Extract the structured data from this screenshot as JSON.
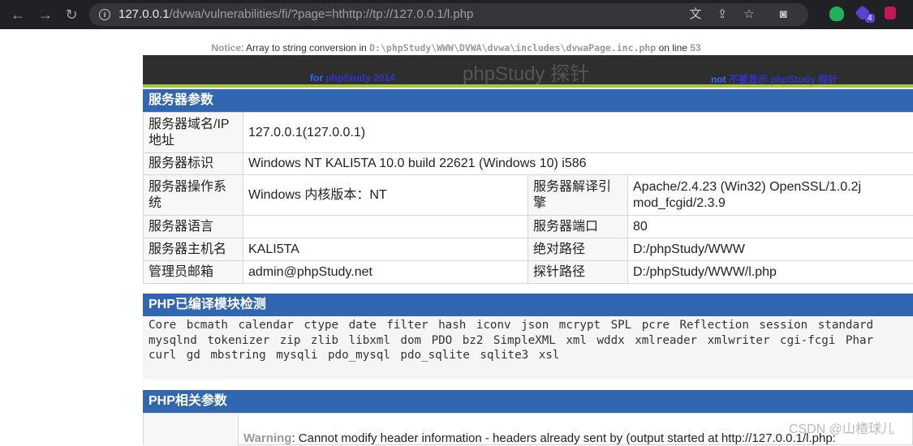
{
  "browser": {
    "url_host": "127.0.0.1",
    "url_path": "/dvwa/vulnerabilities/fi/?page=hthttp://tp://127.0.0.1/l.php",
    "extension_badge": "4"
  },
  "notice": {
    "label": "Notice",
    "message": ": Array to string conversion in ",
    "path": "D:\\phpStudy\\WWW\\DVWA\\dvwa\\includes\\dvwaPage.inc.php",
    "on_line": " on line ",
    "line": "53"
  },
  "banner": {
    "title": "phpStudy 探针",
    "left_prefix": "for ",
    "left_link": "phpStudy 2014",
    "right_prefix": "not ",
    "right_link": "不要显示 phpStudy 探针"
  },
  "server": {
    "heading": "服务器参数",
    "rows": [
      {
        "k1": "服务器域名/IP地址",
        "v1": "127.0.0.1(127.0.0.1)"
      },
      {
        "k1": "服务器标识",
        "v1": "Windows NT KALI5TA 10.0 build 22621 (Windows 10) i586"
      },
      {
        "k1": "服务器操作系统",
        "v1": "Windows  内核版本：NT",
        "k2": "服务器解译引擎",
        "v2": "Apache/2.4.23 (Win32) OpenSSL/1.0.2j mod_fcgid/2.3.9"
      },
      {
        "k1": "服务器语言",
        "v1": "",
        "k2": "服务器端口",
        "v2": "80"
      },
      {
        "k1": "服务器主机名",
        "v1": "KALI5TA",
        "k2": "绝对路径",
        "v2": "D:/phpStudy/WWW"
      },
      {
        "k1": "管理员邮箱",
        "v1": "admin@phpStudy.net",
        "k2": "探针路径",
        "v2": "D:/phpStudy/WWW/l.php"
      }
    ]
  },
  "modules": {
    "heading": "PHP已编译模块检测",
    "text": "Core  bcmath  calendar  ctype  date  filter  hash  iconv  json  mcrypt  SPL  pcre  Reflection  session  standard  mysqlnd  tokenizer  zip  zlib  libxml  dom  PDO  bz2  SimpleXML  xml  wddx  xmlreader  xmlwriter  cgi-fcgi  Phar  curl  gd  mbstring  mysqli  pdo_mysql  pdo_sqlite  sqlite3  xsl"
  },
  "php_params": {
    "heading": "PHP相关参数",
    "warning_label": "Warning",
    "warning_text": ": Cannot modify header information - headers already sent by (output started at http://127.0.0.1/l.php:"
  },
  "watermark": "CSDN @山楂球儿"
}
